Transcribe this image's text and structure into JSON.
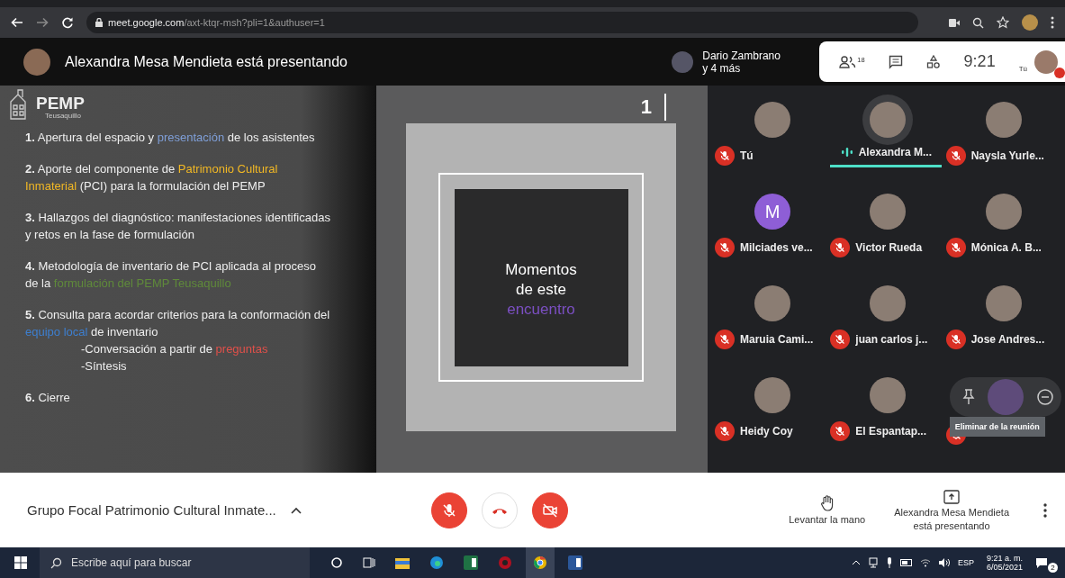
{
  "browser": {
    "url_host": "meet.google.com",
    "url_path": "/axt-ktqr-msh?pli=1&authuser=1"
  },
  "header": {
    "presenting": "Alexandra Mesa Mendieta está presentando",
    "viewers": "Dario Zambrano",
    "viewers_more": "y 4 más",
    "people_count": "18",
    "time": "9:21",
    "self_label": "Tú"
  },
  "slide": {
    "logo": "PEMP",
    "logo_sub": "Teusaquillo",
    "page_number": "1",
    "title_lines": [
      "Momentos",
      "de este"
    ],
    "title_accent": "encuentro",
    "items": [
      {
        "kind": "main",
        "number": "1.",
        "segments": [
          {
            "text": " Apertura del espacio y "
          },
          {
            "text": "presentación",
            "color": "#7f9fd8"
          },
          {
            "text": " de los asistentes"
          }
        ]
      },
      {
        "kind": "main",
        "number": "2.",
        "segments": [
          {
            "text": " Aporte del componente de "
          },
          {
            "text": "Patrimonio Cultural Inmaterial",
            "color": "#f2b824"
          },
          {
            "text": " (PCI) para la formulación del PEMP"
          }
        ]
      },
      {
        "kind": "main",
        "number": "3.",
        "segments": [
          {
            "text": " Hallazgos del diagnóstico: manifestaciones identificadas y retos en la fase de formulación"
          }
        ]
      },
      {
        "kind": "main",
        "number": "4.",
        "segments": [
          {
            "text": " Metodología de inventario de PCI aplicada al proceso de la "
          },
          {
            "text": "formulación del PEMP Teusaquillo",
            "color": "#5f8a3a"
          }
        ]
      },
      {
        "kind": "main",
        "number": "5.",
        "segments": [
          {
            "text": " Consulta para acordar criterios para la conformación del "
          },
          {
            "text": "equipo local",
            "color": "#3d7fd0"
          },
          {
            "text": " de inventario"
          }
        ]
      },
      {
        "kind": "sub",
        "segments": [
          {
            "text": "-Conversación a partir de "
          },
          {
            "text": "preguntas",
            "color": "#e0504a"
          }
        ]
      },
      {
        "kind": "sub",
        "segments": [
          {
            "text": "-Síntesis"
          }
        ]
      },
      {
        "kind": "main",
        "number": "6.",
        "segments": [
          {
            "text": " Cierre"
          }
        ]
      }
    ]
  },
  "participants": [
    {
      "name": "Tú",
      "muted": true,
      "speaking": false,
      "kind": "photo"
    },
    {
      "name": "Alexandra M...",
      "muted": false,
      "speaking": true,
      "kind": "photo"
    },
    {
      "name": "Naysla Yurle...",
      "muted": true,
      "speaking": false,
      "kind": "photo"
    },
    {
      "name": "Milciades ve...",
      "muted": true,
      "speaking": false,
      "kind": "letter",
      "letter": "M",
      "color": "#8e5ed6"
    },
    {
      "name": "Victor Rueda",
      "muted": true,
      "speaking": false,
      "kind": "photo"
    },
    {
      "name": "Mónica A. B...",
      "muted": true,
      "speaking": false,
      "kind": "photo"
    },
    {
      "name": "Maruia Cami...",
      "muted": true,
      "speaking": false,
      "kind": "photo"
    },
    {
      "name": "juan carlos j...",
      "muted": true,
      "speaking": false,
      "kind": "photo"
    },
    {
      "name": "Jose Andres...",
      "muted": true,
      "speaking": false,
      "kind": "photo"
    },
    {
      "name": "Heidy Coy",
      "muted": true,
      "speaking": false,
      "kind": "photo"
    },
    {
      "name": "El Espantap...",
      "muted": true,
      "speaking": false,
      "kind": "photo"
    },
    {
      "muted": true,
      "speaking": false,
      "kind": "hover",
      "tooltip": "Eliminar de la reunión"
    }
  ],
  "bottom": {
    "meeting_title": "Grupo Focal Patrimonio Cultural Inmate...",
    "mic_on": false,
    "camera_on": false,
    "raise_hand": "Levantar la mano",
    "presenter_name": "Alexandra Mesa Mendieta",
    "presenter_status": "está presentando"
  },
  "taskbar": {
    "search_placeholder": "Escribe aquí para buscar",
    "language": "ESP",
    "time": "9:21 a. m.",
    "date": "6/05/2021",
    "notifications": "2"
  }
}
